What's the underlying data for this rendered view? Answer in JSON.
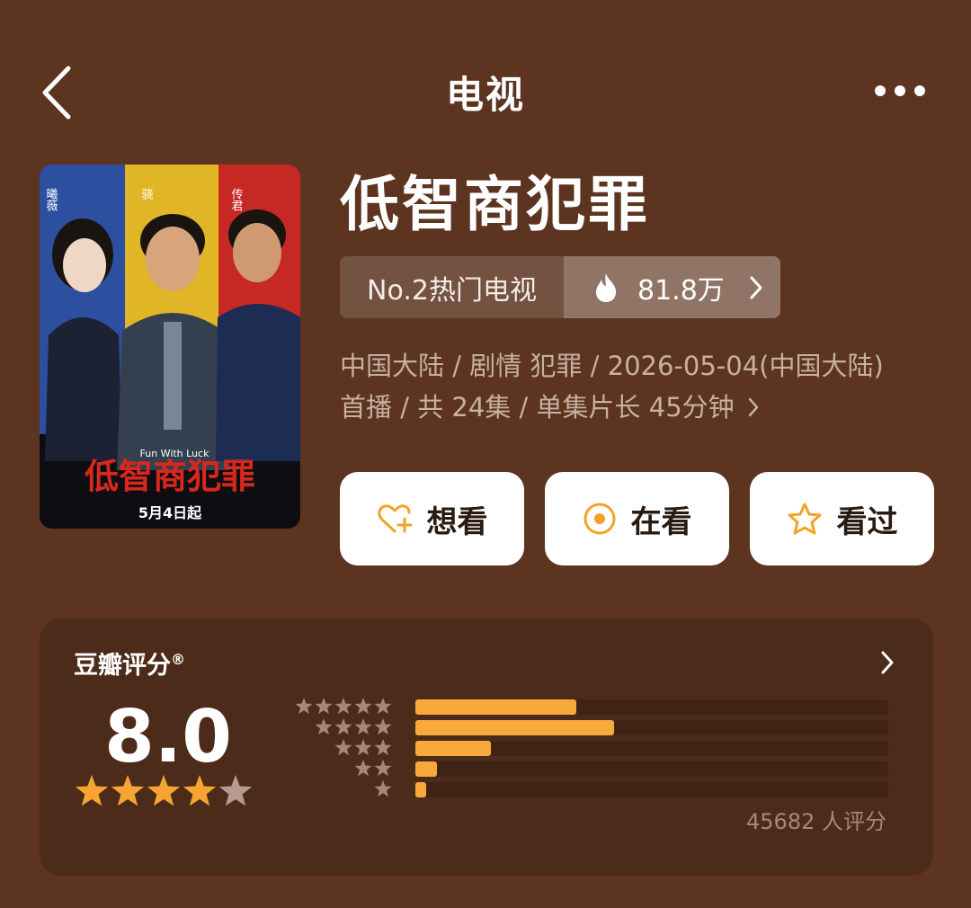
{
  "header": {
    "title": "电视",
    "back_icon": "chevron-left-icon",
    "more_icon": "more-horizontal-icon"
  },
  "poster": {
    "actor_names": [
      "曦薇",
      "骁",
      "传君"
    ],
    "title_art": "低智商犯罪",
    "subtitle_art": "Fun With Luck",
    "date_text": "5月4日起"
  },
  "show": {
    "title": "低智商犯罪",
    "rank_label": "No.2热门电视",
    "heat_value": "81.8万",
    "meta_line1": "中国大陆 / 剧情 犯罪 / 2026-05-04(中国大陆)",
    "meta_line2": "首播 / 共 24集 / 单集片长 45分钟"
  },
  "actions": [
    {
      "label": "想看",
      "icon": "heart-plus-icon"
    },
    {
      "label": "在看",
      "icon": "watching-circle-icon"
    },
    {
      "label": "看过",
      "icon": "star-outline-icon"
    }
  ],
  "rating": {
    "label": "豆瓣评分",
    "label_mark": "®",
    "score": "8.0",
    "stars_filled": 4,
    "stars_total": 5,
    "distribution": [
      {
        "stars": 5,
        "fraction": 0.34
      },
      {
        "stars": 4,
        "fraction": 0.42
      },
      {
        "stars": 3,
        "fraction": 0.16
      },
      {
        "stars": 2,
        "fraction": 0.045
      },
      {
        "stars": 1,
        "fraction": 0.022
      }
    ],
    "votes_text": "45682 人评分"
  },
  "colors": {
    "background": "#5c3420",
    "accent": "#f7a93b",
    "star_filled": "#f6a532",
    "star_empty": "#b59c8e"
  }
}
